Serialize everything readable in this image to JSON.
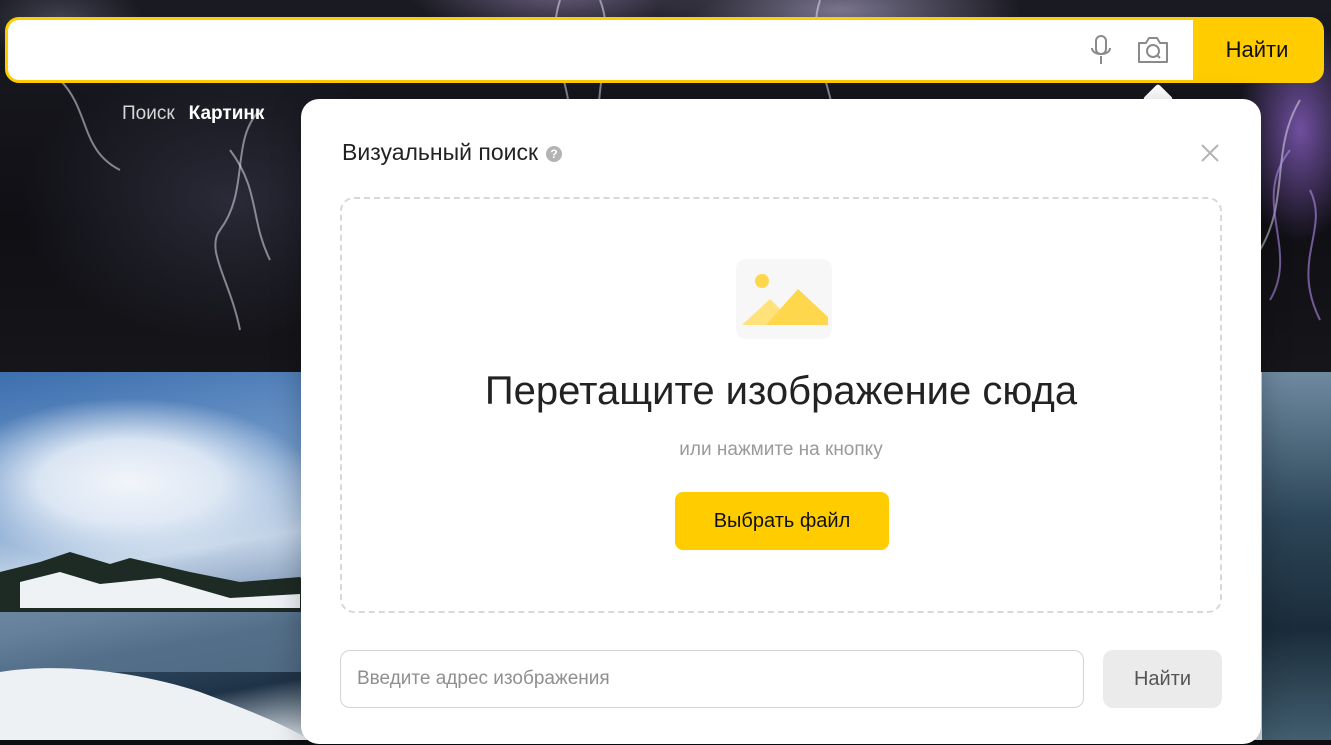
{
  "search": {
    "value": "",
    "placeholder": "",
    "submit_label": "Найти",
    "mic_icon": "microphone-icon",
    "camera_icon": "camera-search-icon"
  },
  "nav": {
    "items": [
      {
        "label": "Поиск",
        "active": false
      },
      {
        "label": "Картинк",
        "active": true
      }
    ]
  },
  "visual_search": {
    "title": "Визуальный поиск",
    "help_icon": "?",
    "close_icon": "close-icon",
    "dropzone": {
      "icon": "image-placeholder-icon",
      "title": "Перетащите изображение сюда",
      "subtitle": "или нажмите на кнопку",
      "button_label": "Выбрать файл"
    },
    "url": {
      "placeholder": "Введите адрес изображения",
      "value": "",
      "submit_label": "Найти"
    }
  },
  "colors": {
    "accent": "#ffcc00",
    "modal_bg": "#ffffff",
    "muted_text": "#9a9a9a"
  }
}
